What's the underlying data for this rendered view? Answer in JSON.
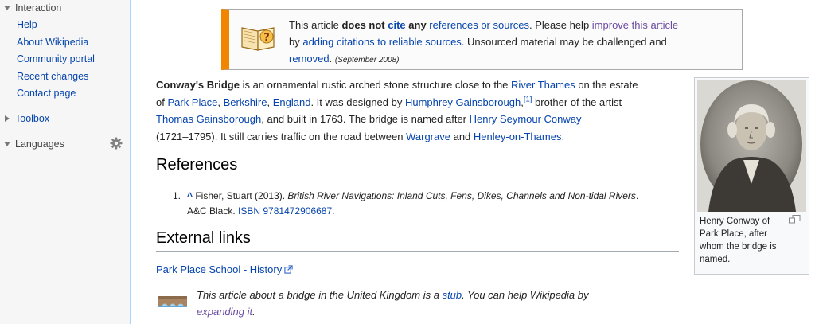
{
  "sidebar": {
    "interaction_heading": "Interaction",
    "interaction_items": [
      {
        "label": "Help"
      },
      {
        "label": "About Wikipedia"
      },
      {
        "label": "Community portal"
      },
      {
        "label": "Recent changes"
      },
      {
        "label": "Contact page"
      }
    ],
    "toolbox_heading": "Toolbox",
    "languages_heading": "Languages"
  },
  "ambox": {
    "t1": "This article ",
    "t2": "does not ",
    "t3": "cite",
    "t4": " any ",
    "t5": "references or sources",
    "t6": ". Please help ",
    "t7": "improve this article",
    "t8": "by ",
    "t9": "adding citations to reliable sources",
    "t10": ". Unsourced material may be challenged and",
    "t11": "removed",
    "t12": ".",
    "date": "(September 2008)"
  },
  "article": {
    "p1": "Conway's Bridge",
    "p2": " is an ornamental rustic arched stone structure close to the ",
    "p3": "River Thames",
    "p4": " on the estate",
    "p5": "of ",
    "p6": "Park Place",
    "p7": ", ",
    "p8": "Berkshire",
    "p9": ", ",
    "p10": "England",
    "p11": ". It was designed by ",
    "p12": "Humphrey Gainsborough",
    "p13": ",",
    "p14": "[1]",
    "p15": " brother of the artist",
    "p16": "Thomas Gainsborough",
    "p17": ", and built in 1763. The bridge is named after ",
    "p18": "Henry Seymour Conway",
    "p19": "(1721–1795). It still carries traffic on the road between ",
    "p20": "Wargrave",
    "p21": " and ",
    "p22": "Henley-on-Thames",
    "p23": "."
  },
  "references": {
    "heading": "References",
    "num": "1.",
    "caret": "^",
    "author": " Fisher, Stuart (2013). ",
    "title": "British River Navigations: Inland Cuts, Fens, Dikes, Channels and Non-tidal Rivers",
    "after_title": ".",
    "publisher": "A&C Black. ",
    "isbn_label": "ISBN",
    "isbn": " 9781472906687",
    "end": "."
  },
  "external_links": {
    "heading": "External links",
    "link": "Park Place School - History"
  },
  "stub": {
    "s1": "This article about a bridge in the United Kingdom is a ",
    "s2": "stub",
    "s3": ". You can help Wikipedia by",
    "s4": "expanding it",
    "s5": "."
  },
  "thumbnail": {
    "caption": "Henry Conway of Park Place, after whom the bridge is named."
  },
  "colors": {
    "link": "#0645ad",
    "visited_link": "#6b4ba1",
    "ambox_border": "#f28500",
    "sidebar_bg": "#f6f6f6"
  },
  "icons": [
    "book-question-icon",
    "external-link-icon",
    "magnify-icon",
    "gear-icon",
    "bridge-stub-icon"
  ]
}
